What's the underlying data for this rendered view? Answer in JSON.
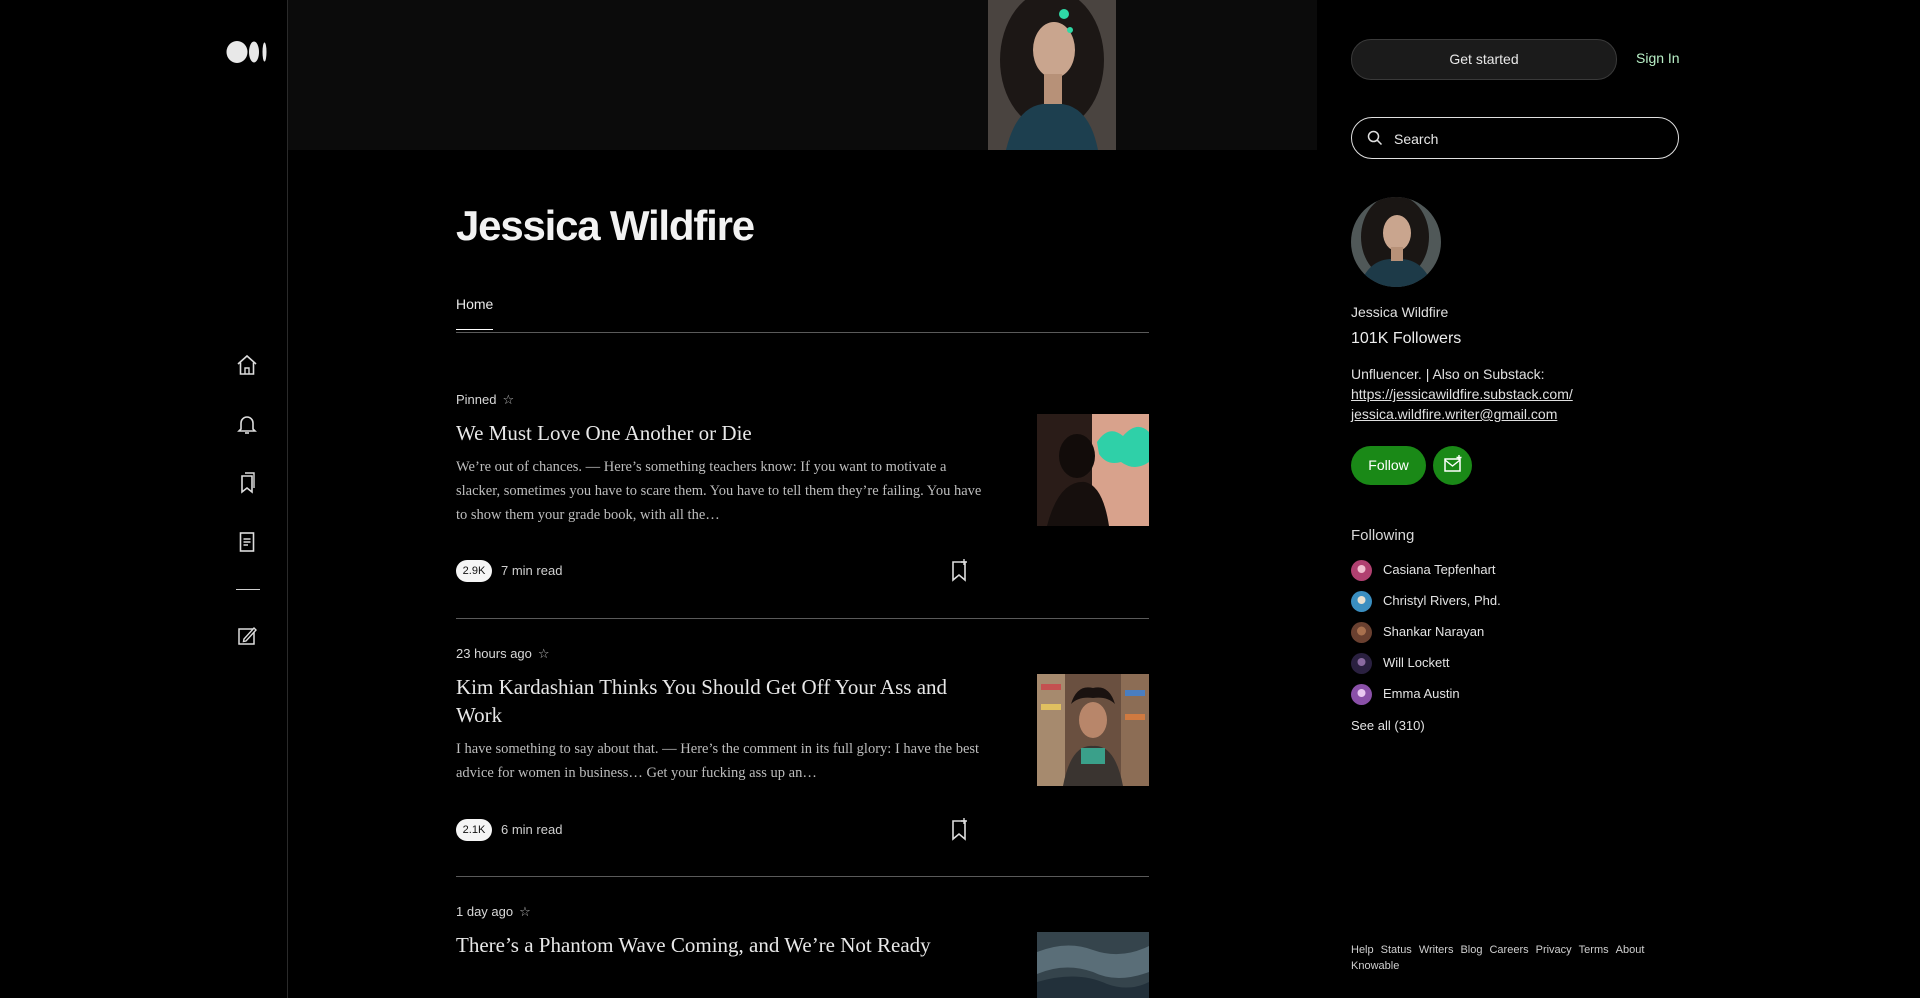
{
  "profile": {
    "name": "Jessica Wildfire"
  },
  "tabs": [
    {
      "label": "Home"
    }
  ],
  "nav": {
    "icons": [
      "medium-logo",
      "home-icon",
      "bell-icon",
      "bookmarks-icon",
      "stories-icon",
      "write-icon"
    ]
  },
  "articles": [
    {
      "meta": "Pinned",
      "title": "We Must Love One Another or Die",
      "excerpt": "We’re out of chances. — Here’s something teachers know: If you want to motivate a slacker, sometimes you have to scare them. You have to tell them they’re failing. You have to show them your grade book, with all the…",
      "clap_chip": "2.9K",
      "read_time": "7 min read"
    },
    {
      "meta": "23 hours ago",
      "title": "Kim Kardashian Thinks You Should Get Off Your Ass and Work",
      "excerpt": "I have something to say about that. — Here’s the comment in its full glory: I have the best advice for women in business… Get your fucking ass up an…",
      "clap_chip": "2.1K",
      "read_time": "6 min read"
    },
    {
      "meta": "1 day ago",
      "title": "There’s a Phantom Wave Coming, and We’re Not Ready"
    }
  ],
  "sidebar": {
    "get_started": "Get started",
    "sign_in": "Sign In",
    "search_placeholder": "Search",
    "name": "Jessica Wildfire",
    "followers": "101K Followers",
    "bio_line": "Unfluencer. | Also on Substack:",
    "bio_link1": "https://jessicawildfire.substack.com/",
    "bio_link2": "jessica.wildfire.writer@gmail.com",
    "follow_label": "Follow",
    "following_heading": "Following",
    "following": [
      {
        "name": "Casiana Tepfenhart"
      },
      {
        "name": "Christyl Rivers, Phd."
      },
      {
        "name": "Shankar Narayan"
      },
      {
        "name": "Will Lockett"
      },
      {
        "name": "Emma Austin"
      }
    ],
    "see_all": "See all (310)",
    "footer": [
      "Help",
      "Status",
      "Writers",
      "Blog",
      "Careers",
      "Privacy",
      "Terms",
      "About",
      "Knowable"
    ]
  },
  "colors": {
    "accent": "#1a8917",
    "background": "#000000",
    "sign_in": "#b9f0c7"
  }
}
